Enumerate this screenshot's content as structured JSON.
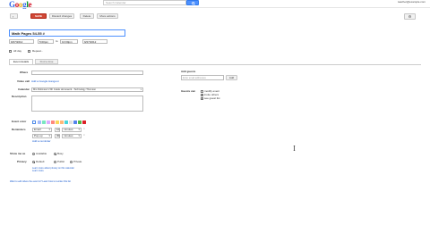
{
  "header": {
    "logo": "Google",
    "search_placeholder": "Search Calendar",
    "search_button": "search-icon",
    "user_email": "teacher@example.com",
    "save_button": "SAVE",
    "discard_button": "Discard changes",
    "delete_button": "Delete",
    "more_actions": "More actions",
    "settings": "gear-icon",
    "logo_colors": [
      "#3369e8",
      "#d50f25",
      "#eeb211",
      "#3369e8",
      "#009925",
      "#d50f25"
    ]
  },
  "event": {
    "title": "Math Pages 54-55 #",
    "start_date": "9/27/2012",
    "start_time": "5:00pm",
    "to_label": "to",
    "end_time": "10:00pm",
    "end_date": "9/27/2012",
    "all_day_label": "All day",
    "repeat_label": "Repeat..."
  },
  "tabs": {
    "details": "Event details",
    "find_time": "Find a time"
  },
  "form": {
    "where_label": "Where",
    "video_call_label": "Video call",
    "video_call_link": "Add a Google Hangout",
    "calendar_label": "Calendar",
    "calendar_value": "Mrs Robinson's 5th Grade Homework - Technology Thomson",
    "description_label": "Description",
    "event_color_label": "Event color",
    "reminders_label": "Reminders",
    "reminder_1_type": "Email",
    "reminder_1_amount": "10",
    "reminder_1_unit": "minutes",
    "reminder_2_type": "Pop-up",
    "reminder_2_amount": "30",
    "reminder_2_unit": "minutes",
    "add_reminder": "Add a reminder",
    "show_me_as_label": "Show me as",
    "available": "Available",
    "busy": "Busy",
    "privacy_label": "Privacy",
    "default": "Default",
    "public": "Public",
    "private": "Private",
    "privacy_help": "Learn more about privacy on this calendar",
    "privacy_help_2": "Learn more",
    "colors": [
      "#a4bdfc",
      "#7ae7bf",
      "#dbadff",
      "#ff887c",
      "#fbd75b",
      "#ffb878",
      "#46d6db",
      "#e1e1e1",
      "#5484ed",
      "#51b749",
      "#dc2127"
    ]
  },
  "guests": {
    "add_label": "Add guests",
    "input_placeholder": "Enter email addresses",
    "add_button": "Add",
    "can_label": "Guests can",
    "modify": "modify event",
    "invite": "invite others",
    "see_list": "see guest list"
  },
  "footer": {
    "text": "Want to edit where the event is? Learn how to reorder this list"
  }
}
